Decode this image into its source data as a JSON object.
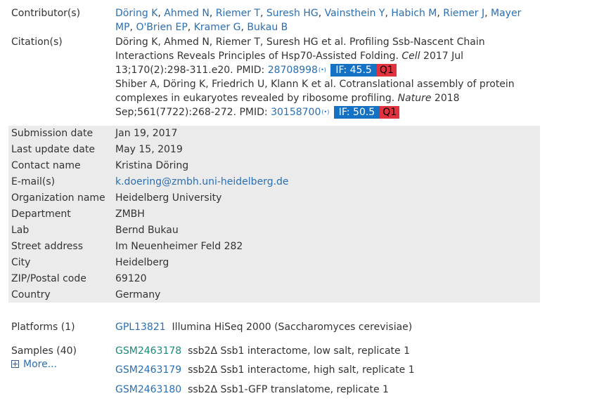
{
  "contributors": {
    "label": "Contributor(s)",
    "names": [
      "Döring K",
      "Ahmed N",
      "Riemer T",
      "Suresh HG",
      "Vainsthein Y",
      "Habich M",
      "Riemer J",
      "Mayer MP",
      "O'Brien EP",
      "Kramer G",
      "Bukau B"
    ]
  },
  "citations": {
    "label": "Citation(s)",
    "items": [
      {
        "text": "Döring K, Ahmed N, Riemer T, Suresh HG et al. Profiling Ssb-Nascent Chain Interactions Reveals Principles of Hsp70-Assisted Folding.",
        "journal": "Cell",
        "details": "2017 Jul 13;170(2):298-311.e20. PMID:",
        "pmid": "28708998",
        "altmetric": "(•)",
        "impact_factor": "IF: 45.5",
        "quartile": "Q1"
      },
      {
        "text": "Shiber A, Döring K, Friedrich U, Klann K et al. Cotranslational assembly of protein complexes in eukaryotes revealed by ribosome profiling.",
        "journal": "Nature",
        "details": "2018 Sep;561(7722):268-272. PMID:",
        "pmid": "30158700",
        "altmetric": "(•)",
        "impact_factor": "IF: 50.5",
        "quartile": "Q1"
      }
    ]
  },
  "submission": {
    "submission_date": {
      "label": "Submission date",
      "value": "Jan 19, 2017"
    },
    "last_update": {
      "label": "Last update date",
      "value": "May 15, 2019"
    },
    "contact_name": {
      "label": "Contact name",
      "value": "Kristina Döring"
    },
    "email": {
      "label": "E-mail(s)",
      "value": "k.doering@zmbh.uni-heidelberg.de"
    },
    "organization": {
      "label": "Organization name",
      "value": "Heidelberg University"
    },
    "department": {
      "label": "Department",
      "value": "ZMBH"
    },
    "lab": {
      "label": "Lab",
      "value": "Bernd Bukau"
    },
    "street": {
      "label": "Street address",
      "value": "Im Neuenheimer Feld 282"
    },
    "city": {
      "label": "City",
      "value": "Heidelberg"
    },
    "zip": {
      "label": "ZIP/Postal code",
      "value": "69120"
    },
    "country": {
      "label": "Country",
      "value": "Germany"
    }
  },
  "platforms": {
    "label": "Platforms (1)",
    "items": [
      {
        "id": "GPL13821",
        "desc": "Illumina HiSeq 2000 (Saccharomyces cerevisiae)"
      }
    ]
  },
  "samples": {
    "label": "Samples (40)",
    "more_label": "More...",
    "items": [
      {
        "id": "GSM2463178",
        "desc": "ssb2Δ Ssb1 interactome, low salt, replicate 1"
      },
      {
        "id": "GSM2463179",
        "desc": "ssb2Δ Ssb1 interactome, high salt, replicate 1"
      },
      {
        "id": "GSM2463180",
        "desc": "ssb2Δ Ssb1-GFP translatome, replicate 1"
      }
    ]
  }
}
